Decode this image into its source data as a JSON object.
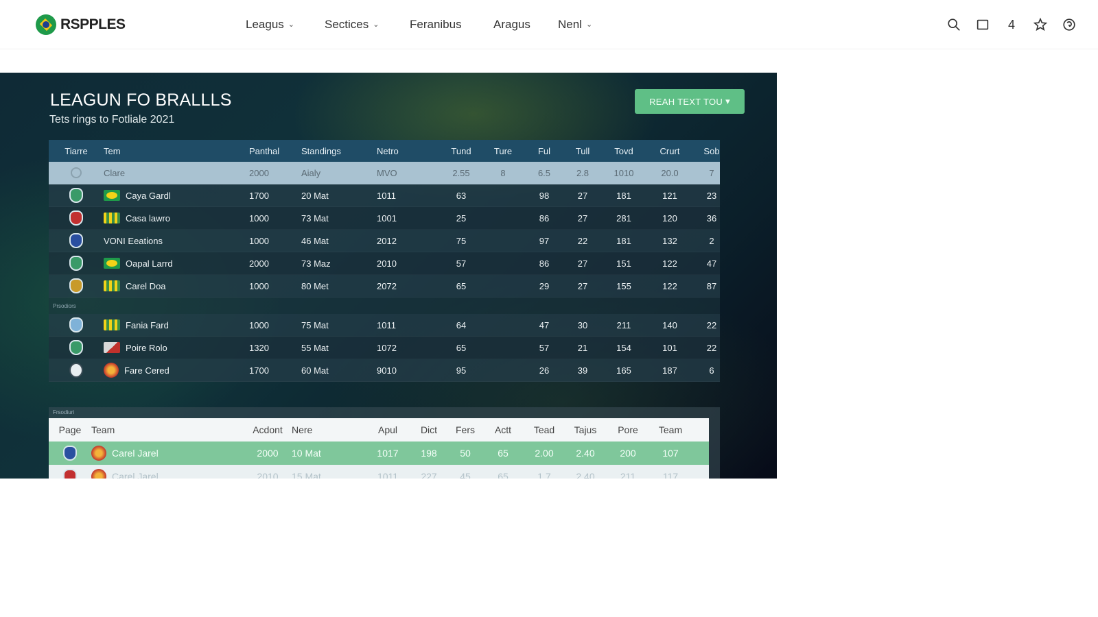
{
  "brand": {
    "name": "RSPPLES"
  },
  "nav": {
    "items": [
      {
        "label": "Leagus",
        "has_dropdown": true
      },
      {
        "label": "Sectices",
        "has_dropdown": true
      },
      {
        "label": "Feranibus",
        "has_dropdown": false
      },
      {
        "label": "Aragus",
        "has_dropdown": false
      },
      {
        "label": "Nenl",
        "has_dropdown": true
      }
    ],
    "icons": [
      "search-icon",
      "square-icon",
      "count-4",
      "star-icon",
      "refresh-icon"
    ],
    "counter": "4"
  },
  "hero": {
    "title": "LEAGUN FO BRALLLS",
    "subtitle": "Tets rings to Fotliale 2021",
    "button_label": "REAH TEXT TOU"
  },
  "table1": {
    "columns": [
      "Tiarre",
      "Tem",
      "Panthal",
      "Standings",
      "Netro",
      "Tund",
      "Ture",
      "Ful",
      "Tull",
      "Tovd",
      "Crurt",
      "Sob"
    ],
    "rows": [
      {
        "crest": "faint",
        "flag": "",
        "team": "Clare",
        "c1": "2000",
        "c2": "Aialy",
        "c3": "MVO",
        "c4": "2.55",
        "c5": "8",
        "c6": "6.5",
        "c7": "2.8",
        "c8": "1010",
        "c9": "20.0",
        "c10": "7",
        "style": "hl"
      },
      {
        "crest": "green",
        "flag": "br",
        "team": "Caya Gardl",
        "c1": "1700",
        "c2": "20 Mat",
        "c3": "1011",
        "c4": "63",
        "c5": "",
        "c6": "98",
        "c7": "27",
        "c8": "181",
        "c9": "121",
        "c10": "23",
        "style": "odd"
      },
      {
        "crest": "red",
        "flag": "gy",
        "team": "Casa lawro",
        "c1": "1000",
        "c2": "73 Mat",
        "c3": "1001",
        "c4": "25",
        "c5": "",
        "c6": "86",
        "c7": "27",
        "c8": "281",
        "c9": "120",
        "c10": "36",
        "style": "even"
      },
      {
        "crest": "blue",
        "flag": "",
        "team": "VONI Eeations",
        "c1": "1000",
        "c2": "46 Mat",
        "c3": "2012",
        "c4": "75",
        "c5": "",
        "c6": "97",
        "c7": "22",
        "c8": "181",
        "c9": "132",
        "c10": "2",
        "style": "odd"
      },
      {
        "crest": "green",
        "flag": "br",
        "team": "Oapal Larrd",
        "c1": "2000",
        "c2": "73 Maz",
        "c3": "2010",
        "c4": "57",
        "c5": "",
        "c6": "86",
        "c7": "27",
        "c8": "151",
        "c9": "122",
        "c10": "47",
        "style": "even"
      },
      {
        "crest": "gold",
        "flag": "gy",
        "team": "Carel Doa",
        "c1": "1000",
        "c2": "80 Met",
        "c3": "2072",
        "c4": "65",
        "c5": "",
        "c6": "29",
        "c7": "27",
        "c8": "155",
        "c9": "122",
        "c10": "87",
        "style": "odd"
      }
    ],
    "group_label": "Prsodiors",
    "rows_b": [
      {
        "crest": "sky",
        "flag": "gy",
        "team": "Fania Fard",
        "c1": "1000",
        "c2": "75 Mat",
        "c3": "1011",
        "c4": "64",
        "c5": "",
        "c6": "47",
        "c7": "30",
        "c8": "211",
        "c9": "140",
        "c10": "22",
        "style": "odd"
      },
      {
        "crest": "green",
        "flag": "rw",
        "team": "Poire Rolo",
        "c1": "1320",
        "c2": "55 Mat",
        "c3": "1072",
        "c4": "65",
        "c5": "",
        "c6": "57",
        "c7": "21",
        "c8": "154",
        "c9": "101",
        "c10": "22",
        "style": "even"
      },
      {
        "crest": "ball",
        "flag": "sun",
        "team": "Fare Cered",
        "c1": "1700",
        "c2": "60 Mat",
        "c3": "9010",
        "c4": "95",
        "c5": "",
        "c6": "26",
        "c7": "39",
        "c8": "165",
        "c9": "187",
        "c10": "6",
        "style": "odd"
      }
    ]
  },
  "table2": {
    "frame_label": "Frsodiuri",
    "columns": [
      "Page",
      "Team",
      "Acdont",
      "Nere",
      "Apul",
      "Dict",
      "Fers",
      "Actt",
      "Tead",
      "Tajus",
      "Pore",
      "Team"
    ],
    "rows": [
      {
        "crest": "blue",
        "team": "Carel Jarel",
        "c1": "2000",
        "c2": "10 Mat",
        "c3": "1017",
        "c4": "198",
        "c5": "50",
        "c6": "65",
        "c7": "2.00",
        "c8": "2.40",
        "c9": "200",
        "c10": "107",
        "style": "green"
      },
      {
        "crest": "red",
        "team": "Carel Jarel",
        "c1": "2010",
        "c2": "15 Mat",
        "c3": "1011",
        "c4": "227",
        "c5": "45",
        "c6": "65",
        "c7": "1.7",
        "c8": "2.40",
        "c9": "211",
        "c10": "117",
        "style": "faded"
      }
    ]
  },
  "colors": {
    "accent_green": "#5fbf86",
    "table_header": "#1f4c66",
    "highlight_row": "#a9c2d1",
    "panel_dark": "#0b1f2a"
  }
}
